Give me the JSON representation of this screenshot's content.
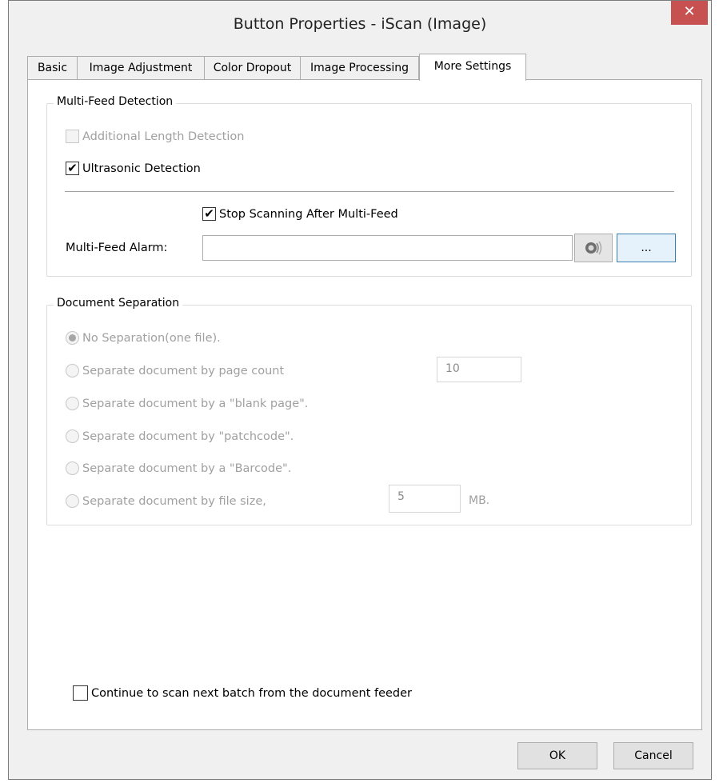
{
  "window": {
    "title": "Button Properties - iScan (Image)",
    "close_label": "✕"
  },
  "tabs": [
    {
      "label": "Basic",
      "active": false
    },
    {
      "label": "Image Adjustment",
      "active": false
    },
    {
      "label": "Color Dropout",
      "active": false
    },
    {
      "label": "Image Processing",
      "active": false
    },
    {
      "label": "More Settings",
      "active": true
    }
  ],
  "multifeed": {
    "group_title": "Multi-Feed Detection",
    "additional_length": {
      "label": "Additional Length Detection",
      "checked": false,
      "enabled": false
    },
    "ultrasonic": {
      "label": "Ultrasonic Detection",
      "checked": true,
      "enabled": true
    },
    "stop_scanning": {
      "label": "Stop Scanning After Multi-Feed",
      "checked": true,
      "enabled": true
    },
    "alarm_label": "Multi-Feed Alarm:",
    "alarm_value": "",
    "browse_label": "..."
  },
  "separation": {
    "group_title": "Document Separation",
    "options": [
      {
        "label": "No Separation(one file).",
        "selected": true
      },
      {
        "label": "Separate document by page count",
        "selected": false
      },
      {
        "label": "Separate document by a \"blank page\".",
        "selected": false
      },
      {
        "label": "Separate document by \"patchcode\".",
        "selected": false
      },
      {
        "label": "Separate document by a \"Barcode\".",
        "selected": false
      },
      {
        "label": "Separate document by file size,",
        "selected": false
      }
    ],
    "page_count_value": "10",
    "file_size_value": "5",
    "file_size_unit": "MB."
  },
  "continue_scan": {
    "label": "Continue to scan next batch from the document feeder",
    "checked": false
  },
  "buttons": {
    "ok": "OK",
    "cancel": "Cancel"
  },
  "colors": {
    "close_button": "#c75050",
    "focus_border": "#3c7fb1"
  }
}
